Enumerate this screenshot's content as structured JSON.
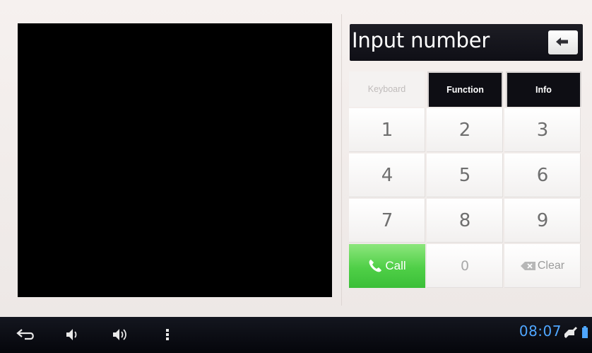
{
  "input": {
    "label": "Input number"
  },
  "tabs": [
    {
      "label": "Keyboard"
    },
    {
      "label": "Function"
    },
    {
      "label": "Info"
    }
  ],
  "keypad": {
    "digits": [
      "1",
      "2",
      "3",
      "4",
      "5",
      "6",
      "7",
      "8",
      "9"
    ],
    "call_label": "Call",
    "zero_label": "0",
    "clear_label": "Clear"
  },
  "statusbar": {
    "time": "08:07"
  },
  "icons": {
    "backspace": "backspace-arrow-icon",
    "call": "phone-icon",
    "clear": "delete-icon",
    "back": "back-icon",
    "volume_down": "volume-down-icon",
    "volume_up": "volume-up-icon",
    "menu": "menu-icon",
    "notification": "notification-icon",
    "battery": "battery-icon"
  },
  "colors": {
    "call_green": "#4fcf47",
    "clock_blue": "#4fa6ff",
    "bar_dark": "#0e0e14"
  }
}
